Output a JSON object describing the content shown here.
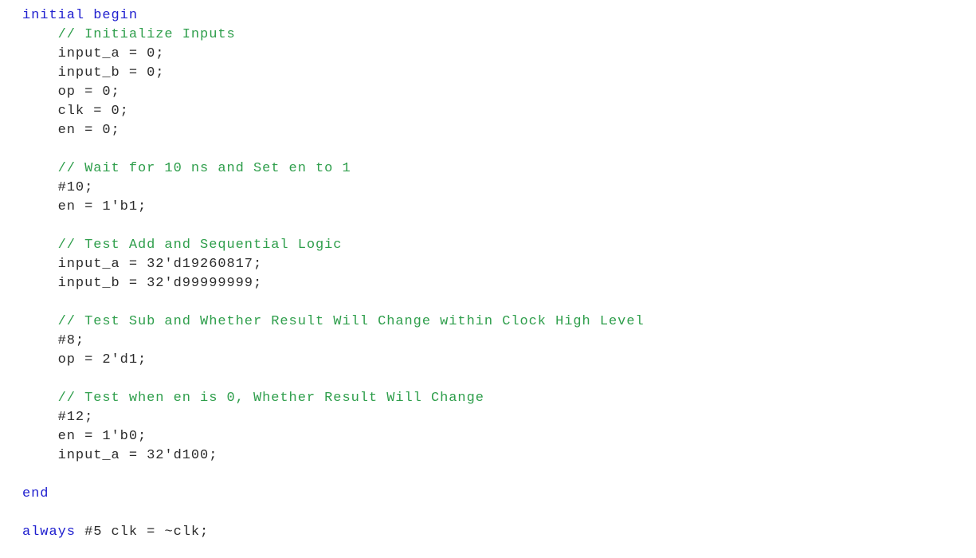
{
  "document": {
    "kind": "source-code-listing",
    "language": "Verilog",
    "background_color": "#ffffff"
  },
  "theme": {
    "keyword_color": "#2020cf",
    "comment_color": "#2e9e4b",
    "plain_color": "#2b2b2b",
    "background_color": "#ffffff"
  },
  "code": {
    "lines": [
      {
        "id": "line-1",
        "text": "initial begin",
        "tokens": [
          {
            "t": "initial begin",
            "c": "keyword"
          }
        ]
      },
      {
        "id": "line-2",
        "text": "    // Initialize Inputs",
        "tokens": [
          {
            "t": "    ",
            "c": "indent"
          },
          {
            "t": "// Initialize Inputs",
            "c": "comment"
          }
        ]
      },
      {
        "id": "line-3",
        "text": "    input_a = 0;",
        "tokens": [
          {
            "t": "    ",
            "c": "indent"
          },
          {
            "t": "input_a = 0;",
            "c": "plain"
          }
        ]
      },
      {
        "id": "line-4",
        "text": "    input_b = 0;",
        "tokens": [
          {
            "t": "    ",
            "c": "indent"
          },
          {
            "t": "input_b = 0;",
            "c": "plain"
          }
        ]
      },
      {
        "id": "line-5",
        "text": "    op = 0;",
        "tokens": [
          {
            "t": "    ",
            "c": "indent"
          },
          {
            "t": "op = 0;",
            "c": "plain"
          }
        ]
      },
      {
        "id": "line-6",
        "text": "    clk = 0;",
        "tokens": [
          {
            "t": "    ",
            "c": "indent"
          },
          {
            "t": "clk = 0;",
            "c": "plain"
          }
        ]
      },
      {
        "id": "line-7",
        "text": "    en = 0;",
        "tokens": [
          {
            "t": "    ",
            "c": "indent"
          },
          {
            "t": "en = 0;",
            "c": "plain"
          }
        ]
      },
      {
        "id": "line-8",
        "text": "",
        "tokens": []
      },
      {
        "id": "line-9",
        "text": "    // Wait for 10 ns and Set en to 1",
        "tokens": [
          {
            "t": "    ",
            "c": "indent"
          },
          {
            "t": "// Wait for 10 ns and Set en to 1",
            "c": "comment"
          }
        ]
      },
      {
        "id": "line-10",
        "text": "    #10;",
        "tokens": [
          {
            "t": "    ",
            "c": "indent"
          },
          {
            "t": "#10;",
            "c": "plain"
          }
        ]
      },
      {
        "id": "line-11",
        "text": "    en = 1'b1;",
        "tokens": [
          {
            "t": "    ",
            "c": "indent"
          },
          {
            "t": "en = 1'b1;",
            "c": "plain"
          }
        ]
      },
      {
        "id": "line-12",
        "text": "",
        "tokens": []
      },
      {
        "id": "line-13",
        "text": "    // Test Add and Sequential Logic",
        "tokens": [
          {
            "t": "    ",
            "c": "indent"
          },
          {
            "t": "// Test Add and Sequential Logic",
            "c": "comment"
          }
        ]
      },
      {
        "id": "line-14",
        "text": "    input_a = 32'd19260817;",
        "tokens": [
          {
            "t": "    ",
            "c": "indent"
          },
          {
            "t": "input_a = 32'd19260817;",
            "c": "plain"
          }
        ]
      },
      {
        "id": "line-15",
        "text": "    input_b = 32'd99999999;",
        "tokens": [
          {
            "t": "    ",
            "c": "indent"
          },
          {
            "t": "input_b = 32'd99999999;",
            "c": "plain"
          }
        ]
      },
      {
        "id": "line-16",
        "text": "",
        "tokens": []
      },
      {
        "id": "line-17",
        "text": "    // Test Sub and Whether Result Will Change within Clock High Level",
        "tokens": [
          {
            "t": "    ",
            "c": "indent"
          },
          {
            "t": "// Test Sub and Whether Result Will Change within Clock High Level",
            "c": "comment"
          }
        ]
      },
      {
        "id": "line-18",
        "text": "    #8;",
        "tokens": [
          {
            "t": "    ",
            "c": "indent"
          },
          {
            "t": "#8;",
            "c": "plain"
          }
        ]
      },
      {
        "id": "line-19",
        "text": "    op = 2'd1;",
        "tokens": [
          {
            "t": "    ",
            "c": "indent"
          },
          {
            "t": "op = 2'd1;",
            "c": "plain"
          }
        ]
      },
      {
        "id": "line-20",
        "text": "",
        "tokens": []
      },
      {
        "id": "line-21",
        "text": "    // Test when en is 0, Whether Result Will Change",
        "tokens": [
          {
            "t": "    ",
            "c": "indent"
          },
          {
            "t": "// Test when en is 0, Whether Result Will Change",
            "c": "comment"
          }
        ]
      },
      {
        "id": "line-22",
        "text": "    #12;",
        "tokens": [
          {
            "t": "    ",
            "c": "indent"
          },
          {
            "t": "#12;",
            "c": "plain"
          }
        ]
      },
      {
        "id": "line-23",
        "text": "    en = 1'b0;",
        "tokens": [
          {
            "t": "    ",
            "c": "indent"
          },
          {
            "t": "en = 1'b0;",
            "c": "plain"
          }
        ]
      },
      {
        "id": "line-24",
        "text": "    input_a = 32'd100;",
        "tokens": [
          {
            "t": "    ",
            "c": "indent"
          },
          {
            "t": "input_a = 32'd100;",
            "c": "plain"
          }
        ]
      },
      {
        "id": "line-25",
        "text": "",
        "tokens": []
      },
      {
        "id": "line-26",
        "text": "end",
        "tokens": [
          {
            "t": "end",
            "c": "keyword"
          }
        ]
      },
      {
        "id": "line-27",
        "text": "",
        "tokens": []
      },
      {
        "id": "line-28",
        "text": "always #5 clk = ~clk;",
        "tokens": [
          {
            "t": "always",
            "c": "keyword"
          },
          {
            "t": " #5 clk = ~clk;",
            "c": "plain"
          }
        ]
      }
    ]
  }
}
